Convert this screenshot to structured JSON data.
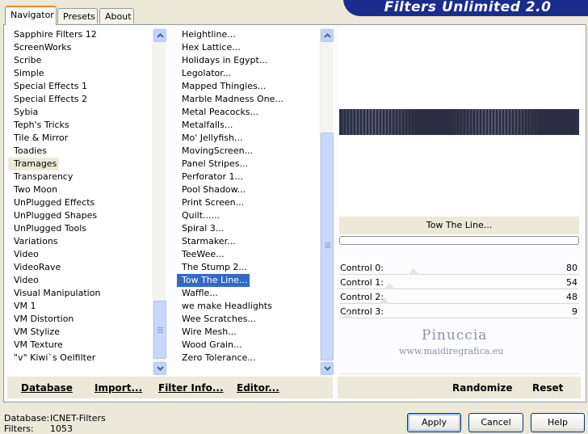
{
  "window": {
    "title": "Filters Unlimited 2.0"
  },
  "tabs": [
    {
      "label": "Navigator",
      "active": true
    },
    {
      "label": "Presets",
      "active": false
    },
    {
      "label": "About",
      "active": false
    }
  ],
  "categories": {
    "items": [
      "Sapphire Filters 12",
      "ScreenWorks",
      "Scribe",
      "Simple",
      "Special Effects 1",
      "Special Effects 2",
      "Sybia",
      "Teph's Tricks",
      "Tile & Mirror",
      "Toadies",
      "Tramages",
      "Transparency",
      "Two Moon",
      "UnPlugged Effects",
      "UnPlugged Shapes",
      "UnPlugged Tools",
      "Variations",
      "Video",
      "VideoRave",
      "Video",
      "Visual Manipulation",
      "VM 1",
      "VM Distortion",
      "VM Stylize",
      "VM Texture",
      "\"v\" Kiwi`s Oelfilter"
    ],
    "selected": "Tramages"
  },
  "filters": {
    "items": [
      "Heightline...",
      "Hex Lattice...",
      "Holidays in Egypt...",
      "Legolator...",
      "Mapped Thingies...",
      "Marble Madness One...",
      "Metal Peacocks...",
      "Metalfalls...",
      "Mo' Jellyfish...",
      "MovingScreen...",
      "Panel Stripes...",
      "Perforator 1...",
      "Pool Shadow...",
      "Print Screen...",
      "Quilt......",
      "Spiral 3...",
      "Starmaker...",
      "TeeWee...",
      "The Stump 2...",
      "Tow The Line...",
      "Waffle...",
      "we make Headlights",
      "Wee Scratches...",
      "Wire Mesh...",
      "Wood Grain...",
      "Zero Tolerance..."
    ],
    "selected": "Tow The Line..."
  },
  "toolbar": {
    "database_label": "Database",
    "import_label": "Import...",
    "filter_info_label": "Filter Info...",
    "editor_label": "Editor...",
    "randomize_label": "Randomize",
    "reset_label": "Reset"
  },
  "preview": {
    "filter_name": "Tow The Line...",
    "controls": [
      {
        "label": "Control 0:",
        "value": "80",
        "fraction": 0.31
      },
      {
        "label": "Control 1:",
        "value": "54",
        "fraction": 0.21
      },
      {
        "label": "Control 2:",
        "value": "48",
        "fraction": 0.19
      },
      {
        "label": "Control 3:",
        "value": "9",
        "fraction": 0.035
      }
    ],
    "watermark_title": "Pinuccia",
    "watermark_url": "www.maidiregrafica.eu"
  },
  "footer": {
    "database_key": "Database:",
    "database_value": "ICNET-Filters",
    "filters_key": "Filters:",
    "filters_value": "1053",
    "apply_label": "Apply",
    "cancel_label": "Cancel",
    "help_label": "Help"
  },
  "colors": {
    "banner": "#1a2d8c",
    "selection": "#316ac5",
    "face": "#ece9d8"
  }
}
